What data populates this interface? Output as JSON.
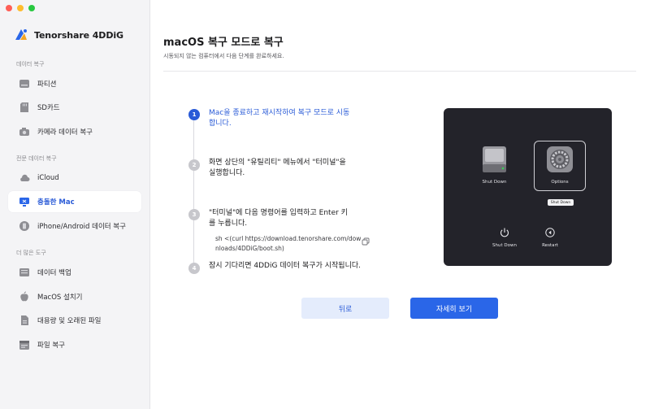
{
  "app": {
    "name": "Tenorshare 4DDiG"
  },
  "window_controls": {
    "close": "#ff5f57",
    "minimize": "#febc2e",
    "zoom": "#28c840"
  },
  "sidebar": {
    "section1": "데이터 복구",
    "section2": "전문 데이터 복구",
    "section3": "더 많은 도구",
    "items": [
      {
        "label": "파티션",
        "icon": "drive-icon"
      },
      {
        "label": "SD카드",
        "icon": "sd-card-icon"
      },
      {
        "label": "카메라 데이터 복구",
        "icon": "camera-icon"
      },
      {
        "label": "iCloud",
        "icon": "cloud-icon"
      },
      {
        "label": "충돌한 Mac",
        "icon": "crashed-mac-icon",
        "active": true
      },
      {
        "label": "iPhone/Android 데이터 복구",
        "icon": "phone-icon"
      },
      {
        "label": "데이터 백업",
        "icon": "backup-icon"
      },
      {
        "label": "MacOS 설치기",
        "icon": "apple-icon"
      },
      {
        "label": "대용량 및 오래된 파일",
        "icon": "large-file-icon"
      },
      {
        "label": "파일 복구",
        "icon": "file-repair-icon"
      }
    ]
  },
  "main": {
    "title": "macOS 복구 모드로 복구",
    "subtitle": "시동되지 않는 컴퓨터에서 다음 단계를 완료하세요.",
    "steps": [
      {
        "num": "1",
        "text": "Mac을 종료하고 재시작하여 복구 모드로 시동합니다."
      },
      {
        "num": "2",
        "text": "화면 상단의 \"유틸리티\" 메뉴에서 \"터미널\"을 실행합니다."
      },
      {
        "num": "3",
        "text": "\"터미널\"에 다음 명령어를 입력하고 Enter 키를 누릅니다."
      },
      {
        "num": "4",
        "text": "잠시 기다리면 4DDiG 데이터 복구가 시작됩니다."
      }
    ],
    "command": "sh <(curl https://download.tenorshare.com/downloads/4DDiG/boot.sh)",
    "preview": {
      "disk_label": "Shut Down",
      "options_label": "Options",
      "tooltip": "Shut Down",
      "shutdown_label": "Shut Down",
      "restart_label": "Restart"
    },
    "buttons": {
      "back": "뒤로",
      "more": "자세히 보기"
    }
  },
  "colors": {
    "accent": "#2a5bd7",
    "primary_button": "#2a66e8",
    "preview_bg": "#23232a"
  }
}
